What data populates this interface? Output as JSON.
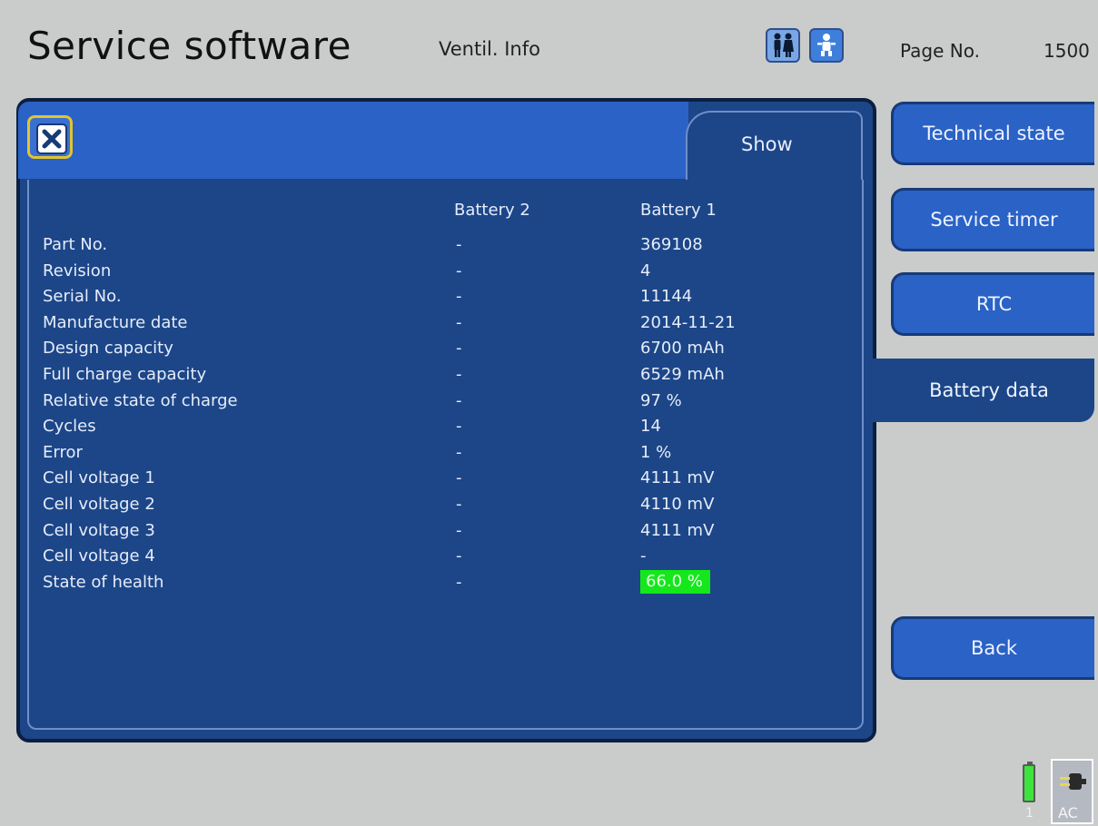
{
  "header": {
    "app_title": "Service software",
    "screen_name": "Ventil. Info",
    "page_label": "Page No.",
    "page_number": "1500",
    "mode_icons": [
      "adult-patients-icon",
      "infant-icon"
    ]
  },
  "panel": {
    "tab_label": "Show",
    "close_icon": "close-icon",
    "columns": [
      "Battery 2",
      "Battery 1"
    ],
    "rows": [
      {
        "label": "Part No.",
        "battery2": "-",
        "battery1": "369108"
      },
      {
        "label": "Revision",
        "battery2": "-",
        "battery1": "4"
      },
      {
        "label": "Serial No.",
        "battery2": "-",
        "battery1": "11144"
      },
      {
        "label": "Manufacture date",
        "battery2": "-",
        "battery1": "2014-11-21"
      },
      {
        "label": "Design capacity",
        "battery2": "-",
        "battery1": "6700 mAh"
      },
      {
        "label": "Full charge capacity",
        "battery2": "-",
        "battery1": "6529 mAh"
      },
      {
        "label": "Relative state of charge",
        "battery2": "-",
        "battery1": "97 %"
      },
      {
        "label": "Cycles",
        "battery2": "-",
        "battery1": "14"
      },
      {
        "label": "Error",
        "battery2": "-",
        "battery1": "1 %"
      },
      {
        "label": "Cell voltage 1",
        "battery2": "-",
        "battery1": "4111 mV"
      },
      {
        "label": "Cell voltage 2",
        "battery2": "-",
        "battery1": "4110 mV"
      },
      {
        "label": "Cell voltage 3",
        "battery2": "-",
        "battery1": "4111 mV"
      },
      {
        "label": "Cell voltage 4",
        "battery2": "-",
        "battery1": "-"
      },
      {
        "label": "State of health",
        "battery2": "-",
        "battery1": "66.0 %"
      }
    ],
    "health_highlight_color": "#14e81a"
  },
  "sidebar": {
    "technical_state": "Technical state",
    "service_timer": "Service timer",
    "rtc": "RTC",
    "battery_data": "Battery data",
    "back": "Back"
  },
  "status": {
    "battery_number": "1",
    "power_label": "AC",
    "battery_color": "#3ee33e"
  },
  "colors": {
    "panel": "#1c4688",
    "button": "#2a62c6",
    "background": "#c9ccca"
  }
}
